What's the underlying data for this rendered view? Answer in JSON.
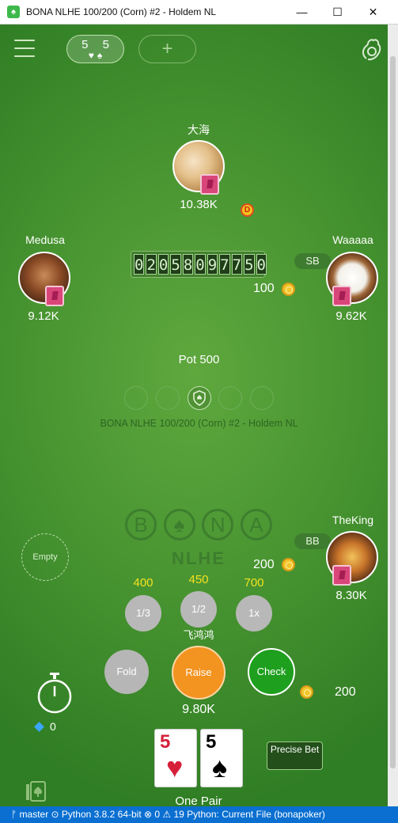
{
  "window": {
    "title": "BONA NLHE 100/200 (Corn) #2 - Holdem NL",
    "app_icon": "app-logo-icon",
    "minimize": "—",
    "maximize": "☐",
    "close": "✕"
  },
  "toolbar": {
    "menu_icon": "hamburger-menu-icon",
    "hand_values": "5 5",
    "hand_suits": "♥♠",
    "add_table": "+",
    "hand_icon": "hand-raise-icon"
  },
  "players": {
    "top": {
      "name": "大海",
      "stack": "10.38K"
    },
    "left": {
      "name": "Medusa",
      "stack": "9.12K"
    },
    "right": {
      "name": "Waaaaa",
      "stack": "9.62K",
      "position": "SB",
      "bet": "100"
    },
    "bottom_right": {
      "name": "TheKing",
      "stack": "8.30K",
      "position": "BB",
      "bet": "200"
    },
    "empty_seat": "Empty",
    "dealer_button": "D"
  },
  "table": {
    "hand_id_digits": [
      "0",
      "2",
      "0",
      "5",
      "8",
      "0",
      "9",
      "7",
      "7",
      "5",
      "0"
    ],
    "pot": "Pot 500",
    "name": "BONA NLHE 100/200 (Corn) #2 - Holdem NL",
    "logo_letters": [
      "B",
      "♠",
      "N",
      "A"
    ],
    "logo_sub": "NLHE"
  },
  "hero": {
    "name": "飞鸿鸿",
    "stack": "9.80K",
    "call_amount": "200",
    "gems": "0",
    "hand_rank": "One Pair",
    "cards": [
      {
        "rank": "5",
        "suit": "♥",
        "color": "#d6203a"
      },
      {
        "rank": "5",
        "suit": "♠",
        "color": "#000000"
      }
    ]
  },
  "presets": [
    {
      "value": "400",
      "label": "1/3"
    },
    {
      "value": "450",
      "label": "1/2"
    },
    {
      "value": "700",
      "label": "1x"
    }
  ],
  "actions": {
    "fold": "Fold",
    "raise": "Raise",
    "check": "Check",
    "precise_bet": "Precise Bet"
  },
  "statusbar": "ᚠ master   ⊙  Python 3.8.2 64-bit   ⊗ 0 ⚠ 19   Python: Current File (bonapoker)",
  "colors": {
    "felt": "#4a9632",
    "raise": "#f39320",
    "check": "#1e9f1e",
    "fold": "#b6b6b6",
    "preset_value": "#f5e11f"
  }
}
